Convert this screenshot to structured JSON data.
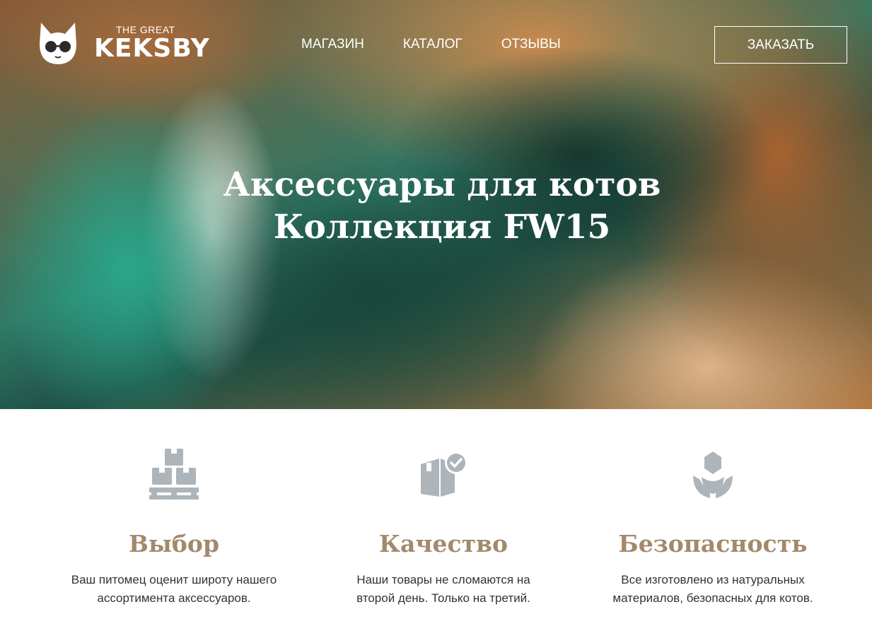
{
  "header": {
    "logo_small": "THE GREAT",
    "logo_big": "KEKSBY",
    "nav": [
      {
        "label": "МАГАЗИН"
      },
      {
        "label": "КАТАЛОГ"
      },
      {
        "label": "ОТЗЫВЫ"
      }
    ],
    "order_label": "ЗАКАЗАТЬ"
  },
  "hero": {
    "title_line1": "Аксессуары для котов",
    "title_line2": "Коллекция FW15"
  },
  "features": [
    {
      "icon": "boxes-pallet-icon",
      "title": "Выбор",
      "line1": "Ваш питомец оценит широту нашего",
      "line2": "ассортимента аксессуаров."
    },
    {
      "icon": "box-check-icon",
      "title": "Качество",
      "line1": "Наши товары не сломаются на",
      "line2": "второй день. Только на третий."
    },
    {
      "icon": "flower-icon",
      "title": "Безопасность",
      "line1": "Все изготовлено из натуральных",
      "line2": "материалов, безопасных для котов."
    }
  ],
  "colors": {
    "accent": "#a3896b",
    "icon": "#adb5bb",
    "text": "#333333"
  }
}
